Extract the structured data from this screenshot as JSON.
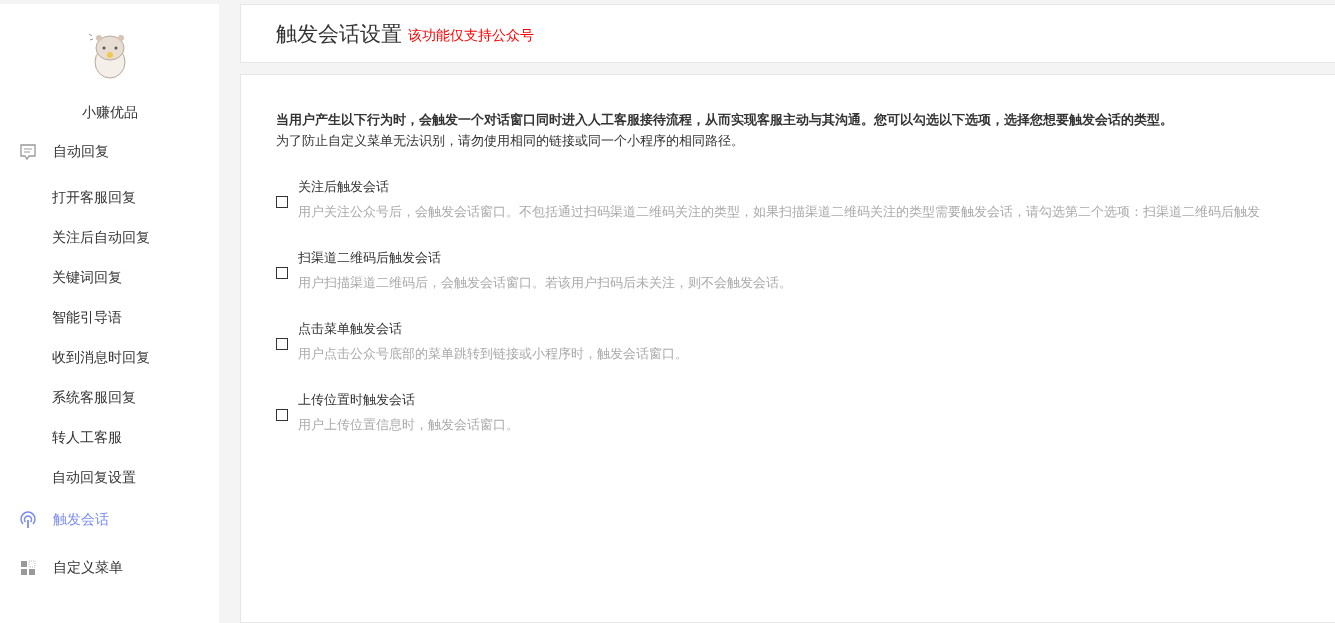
{
  "sidebar": {
    "brand": "小赚优品",
    "items": [
      {
        "label": "自动回复",
        "selected": false,
        "children": [
          {
            "label": "打开客服回复",
            "selected": false
          },
          {
            "label": "关注后自动回复",
            "selected": false
          },
          {
            "label": "关键词回复",
            "selected": false
          },
          {
            "label": "智能引导语",
            "selected": false
          },
          {
            "label": "收到消息时回复",
            "selected": false
          },
          {
            "label": "系统客服回复",
            "selected": false
          },
          {
            "label": "转人工客服",
            "selected": false
          },
          {
            "label": "自动回复设置",
            "selected": false
          }
        ]
      },
      {
        "label": "触发会话",
        "selected": true
      },
      {
        "label": "自定义菜单",
        "selected": false
      }
    ]
  },
  "header": {
    "title": "触发会话设置",
    "notice": "该功能仅支持公众号"
  },
  "intro": {
    "bold_text": "当用户产生以下行为时，会触发一个对话窗口同时进入人工客服接待流程，从而实现客服主动与其沟通。您可以勾选以下选项，选择您想要触发会话的类型。",
    "note": "为了防止自定义菜单无法识别，请勿使用相同的链接或同一个小程序的相同路径。"
  },
  "options": [
    {
      "label": "关注后触发会话",
      "checked": false,
      "description": "用户关注公众号后，会触发会话窗口。不包括通过扫码渠道二维码关注的类型，如果扫描渠道二维码关注的类型需要触发会话，请勾选第二个选项：扫渠道二维码后触发"
    },
    {
      "label": "扫渠道二维码后触发会话",
      "checked": false,
      "description": "用户扫描渠道二维码后，会触发会话窗口。若该用户扫码后未关注，则不会触发会话。"
    },
    {
      "label": "点击菜单触发会话",
      "checked": false,
      "description": "用户点击公众号底部的菜单跳转到链接或小程序时，触发会话窗口。"
    },
    {
      "label": "上传位置时触发会话",
      "checked": false,
      "description": "用户上传位置信息时，触发会话窗口。"
    }
  ]
}
